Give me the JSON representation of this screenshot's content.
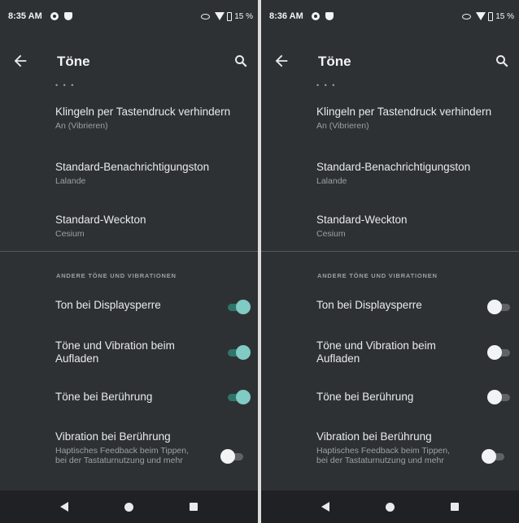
{
  "screens": [
    {
      "status": {
        "time": "8:35 AM",
        "battery_text": "15 %"
      },
      "appbar": {
        "title": "Töne"
      },
      "prefs": [
        {
          "title": "Klingeln per Tastendruck verhindern",
          "summary": "An (Vibrieren)"
        },
        {
          "title": "Standard-Benachrichtigungston",
          "summary": "Lalande"
        },
        {
          "title": "Standard-Weckton",
          "summary": "Cesium"
        }
      ],
      "category": "ANDERE TÖNE UND VIBRATIONEN",
      "toggles": [
        {
          "title": "Ton bei Displaysperre",
          "summary": "",
          "on": true
        },
        {
          "title": "Töne und Vibration beim Aufladen",
          "summary": "",
          "on": true
        },
        {
          "title": "Töne bei Berührung",
          "summary": "",
          "on": true
        },
        {
          "title": "Vibration bei Berührung",
          "summary": "Haptisches Feedback beim Tippen, bei der Tastaturnutzung und mehr",
          "on": false
        }
      ]
    },
    {
      "status": {
        "time": "8:36 AM",
        "battery_text": "15 %"
      },
      "appbar": {
        "title": "Töne"
      },
      "prefs": [
        {
          "title": "Klingeln per Tastendruck verhindern",
          "summary": "An (Vibrieren)"
        },
        {
          "title": "Standard-Benachrichtigungston",
          "summary": "Lalande"
        },
        {
          "title": "Standard-Weckton",
          "summary": "Cesium"
        }
      ],
      "category": "ANDERE TÖNE UND VIBRATIONEN",
      "toggles": [
        {
          "title": "Ton bei Displaysperre",
          "summary": "",
          "on": false
        },
        {
          "title": "Töne und Vibration beim Aufladen",
          "summary": "",
          "on": false
        },
        {
          "title": "Töne bei Berührung",
          "summary": "",
          "on": false
        },
        {
          "title": "Vibration bei Berührung",
          "summary": "Haptisches Feedback beim Tippen, bei der Tastaturnutzung und mehr",
          "on": false
        }
      ]
    }
  ],
  "icons": {
    "status_left": [
      "gear-icon",
      "shield-icon"
    ],
    "status_right": [
      "eye-icon",
      "wifi-icon",
      "battery-icon"
    ],
    "appbar": [
      "back-arrow-icon",
      "search-icon"
    ],
    "nav": [
      "nav-back-icon",
      "nav-home-icon",
      "nav-recents-icon"
    ]
  },
  "colors": {
    "background": "#2e3134",
    "navbar": "#202124",
    "switch_on_thumb": "#80cbc4",
    "switch_on_track": "#2e7568",
    "switch_off_thumb": "#f1f3f4",
    "switch_off_track": "#5f6368"
  }
}
